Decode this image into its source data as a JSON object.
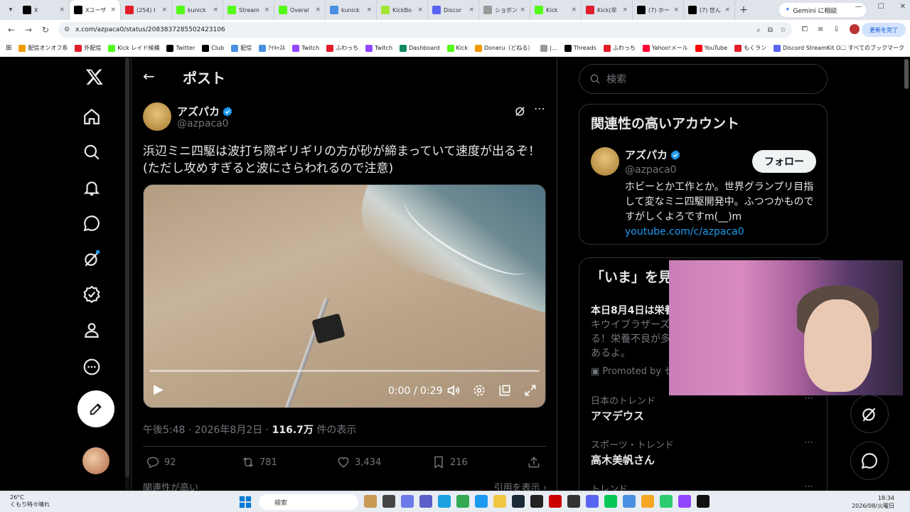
{
  "browser": {
    "tabs": [
      {
        "label": "X",
        "color": "#000000"
      },
      {
        "label": "Xユーザ",
        "color": "#000000",
        "active": true
      },
      {
        "label": "(254) I",
        "color": "#e11d2a"
      },
      {
        "label": "kunick",
        "color": "#53fc18"
      },
      {
        "label": "Stream",
        "color": "#53fc18"
      },
      {
        "label": "Overal",
        "color": "#53fc18"
      },
      {
        "label": "kunick",
        "color": "#4a90e2"
      },
      {
        "label": "KickBo",
        "color": "#a3e635"
      },
      {
        "label": "Discor",
        "color": "#5865f2"
      },
      {
        "label": "ショボン",
        "color": "#999999"
      },
      {
        "label": "Kick",
        "color": "#53fc18"
      },
      {
        "label": "Kick(非",
        "color": "#e11d2a"
      },
      {
        "label": "(7) ホー",
        "color": "#000000"
      },
      {
        "label": "(7) 世ん",
        "color": "#000000"
      }
    ],
    "gemini_button": "Gemini に相談",
    "url": "x.com/azpaca0/status/2083837285502423106",
    "update_button": "更新を完了",
    "bookmarks": [
      {
        "label": "配信オンオフ系",
        "color": "#f29900"
      },
      {
        "label": "外配信",
        "color": "#e11d2a"
      },
      {
        "label": "Kick レイド候補",
        "color": "#53fc18"
      },
      {
        "label": "Twitter",
        "color": "#000000"
      },
      {
        "label": "Club",
        "color": "#000000"
      },
      {
        "label": "配信",
        "color": "#4a90e2"
      },
      {
        "label": "ｱｲｷｬｽﾙ",
        "color": "#4a90e2"
      },
      {
        "label": "Twitch",
        "color": "#9146ff"
      },
      {
        "label": "ふわっち",
        "color": "#e11d2a"
      },
      {
        "label": "Twitch",
        "color": "#9146ff"
      },
      {
        "label": "Dashboard",
        "color": "#0f8a5f"
      },
      {
        "label": "Kick",
        "color": "#53fc18"
      },
      {
        "label": "Doneru（どねる）",
        "color": "#f29900"
      },
      {
        "label": "|...",
        "color": "#999999"
      },
      {
        "label": "Threads",
        "color": "#000000"
      },
      {
        "label": "ふわっち",
        "color": "#e11d2a"
      },
      {
        "label": "Yahoo!メール",
        "color": "#ff0033"
      },
      {
        "label": "YouTube",
        "color": "#ff0000"
      },
      {
        "label": "もくラン",
        "color": "#e11d2a"
      },
      {
        "label": "Discord StreamKit O...",
        "color": "#5865f2"
      }
    ],
    "all_bookmarks": "すべてのブックマーク"
  },
  "header": {
    "title": "ポスト"
  },
  "post": {
    "author_name": "アズパカ",
    "author_handle": "@azpaca0",
    "text_line1": "浜辺ミニ四駆は波打ち際ギリギリの方が砂が締まっていて速度が出るぞ！",
    "text_line2": "(ただし攻めすぎると波にさらわれるので注意)",
    "video_time": "0:00 / 0:29",
    "timestamp": "午後5:48 · 2026年8月2日 · ",
    "views": "116.7万",
    "views_label": " 件の表示",
    "replies": "92",
    "reposts": "781",
    "likes": "3,434",
    "bookmarks": "216",
    "related_left": "関連性が高い",
    "quotes_right": "引用を表示 ›"
  },
  "sidebar": {
    "search_placeholder": "検索",
    "related_title": "関連性の高いアカウント",
    "related_name": "アズパカ",
    "related_handle": "@azpaca0",
    "follow_label": "フォロー",
    "bio": "ホビーとか工作とか。世界グランプリ目指して変なミニ四駆開発中。ふつつかものですがしくよろですm(__)m",
    "bio_link": "youtube.com/c/azpaca0",
    "now_title": "「いま」を見",
    "promo_head": "本日8月4日は栄養",
    "promo_body1": "キウイブラザーズ",
    "promo_body2": "る！栄養不良が多",
    "promo_body3": "あるよ。",
    "promoted": "Promoted by ゼ",
    "trends": [
      {
        "category": "日本のトレンド",
        "name": "アマデウス"
      },
      {
        "category": "スポーツ・トレンド",
        "name": "高木美帆さん"
      },
      {
        "category": "トレンド",
        "name": ""
      }
    ]
  },
  "taskbar": {
    "weather_temp": "26°C",
    "weather_desc": "くもり時々晴れ",
    "search": "検索",
    "time": "18:34",
    "date": "2026/08/火曜日"
  }
}
